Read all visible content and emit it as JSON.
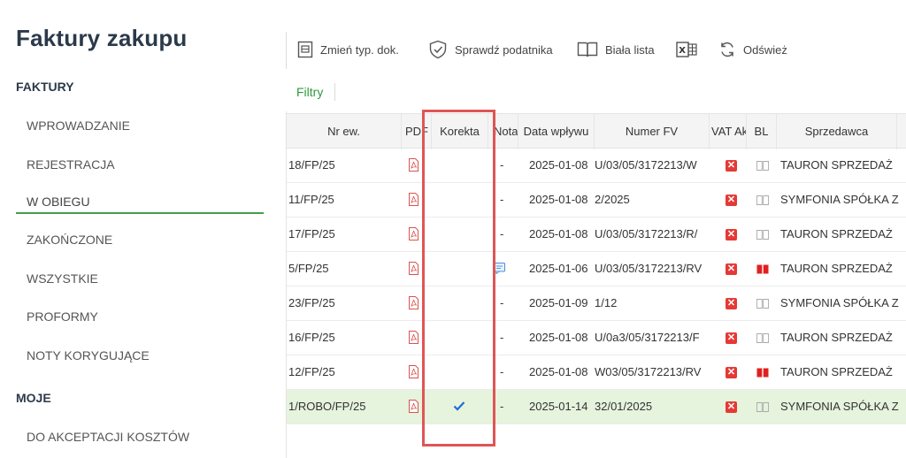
{
  "app": {
    "title": "Faktury zakupu"
  },
  "sidebar": {
    "section_faktury": "FAKTURY",
    "items": [
      {
        "label": "WPROWADZANIE"
      },
      {
        "label": "REJESTRACJA"
      },
      {
        "label": "W OBIEGU"
      },
      {
        "label": "ZAKOŃCZONE"
      },
      {
        "label": "WSZYSTKIE"
      },
      {
        "label": "PROFORMY"
      },
      {
        "label": "NOTY KORYGUJĄCE"
      }
    ],
    "active_item": "W OBIEGU",
    "section_moje": "MOJE",
    "moje_items": [
      {
        "label": "DO AKCEPTACJI KOSZTÓW"
      }
    ]
  },
  "toolbar": {
    "change_type": "Zmień typ. dok.",
    "verify_taxpayer": "Sprawdź podatnika",
    "white_list": "Biała lista",
    "excel_icon": "excel-icon",
    "refresh": "Odśwież"
  },
  "filters": {
    "label": "Filtry"
  },
  "table": {
    "headers": {
      "nr_ew": "Nr ew.",
      "pdf": "PDF",
      "korekta": "Korekta",
      "nota": "Nota",
      "data_wplywu": "Data wpływu",
      "numer_fv": "Numer FV",
      "vat_ak": "VAT Ak",
      "bl": "BL",
      "sprzedawca": "Sprzedawca"
    },
    "rows": [
      {
        "nr_ew": "18/FP/25",
        "korekta": "",
        "nota": "-",
        "data_wplywu": "2025-01-08",
        "numer_fv": "U/03/05/3172213/W",
        "bl": "empty",
        "sprzedawca": "TAURON SPRZEDAŻ"
      },
      {
        "nr_ew": "11/FP/25",
        "korekta": "",
        "nota": "-",
        "data_wplywu": "2025-01-08",
        "numer_fv": "2/2025",
        "bl": "empty",
        "sprzedawca": "SYMFONIA SPÓŁKA Z"
      },
      {
        "nr_ew": "17/FP/25",
        "korekta": "",
        "nota": "-",
        "data_wplywu": "2025-01-08",
        "numer_fv": "U/03/05/3172213/R/",
        "bl": "empty",
        "sprzedawca": "TAURON SPRZEDAŻ"
      },
      {
        "nr_ew": "5/FP/25",
        "korekta": "",
        "nota": "note",
        "data_wplywu": "2025-01-06",
        "numer_fv": "U/03/05/3172213/RV",
        "bl": "red",
        "sprzedawca": "TAURON SPRZEDAŻ"
      },
      {
        "nr_ew": "23/FP/25",
        "korekta": "",
        "nota": "-",
        "data_wplywu": "2025-01-09",
        "numer_fv": "1/12",
        "bl": "empty",
        "sprzedawca": "SYMFONIA SPÓŁKA Z"
      },
      {
        "nr_ew": "16/FP/25",
        "korekta": "",
        "nota": "-",
        "data_wplywu": "2025-01-08",
        "numer_fv": "U/0a3/05/3172213/F",
        "bl": "empty",
        "sprzedawca": "TAURON SPRZEDAŻ"
      },
      {
        "nr_ew": "12/FP/25",
        "korekta": "",
        "nota": "-",
        "data_wplywu": "2025-01-08",
        "numer_fv": "W03/05/3172213/RV",
        "bl": "red",
        "sprzedawca": "TAURON SPRZEDAŻ"
      },
      {
        "nr_ew": "1/ROBO/FP/25",
        "korekta": "check",
        "nota": "-",
        "data_wplywu": "2025-01-14",
        "numer_fv": "32/01/2025",
        "bl": "empty",
        "sprzedawca": "SYMFONIA SPÓŁKA Z",
        "selected": true
      }
    ]
  },
  "colors": {
    "accent": "#43a047",
    "filters": "#2e9b3c",
    "highlight": "#e05555",
    "vat_error": "#e53935",
    "selected_row": "#e6f3dd",
    "bl_red": "#e02020",
    "check": "#1e6fd9"
  }
}
